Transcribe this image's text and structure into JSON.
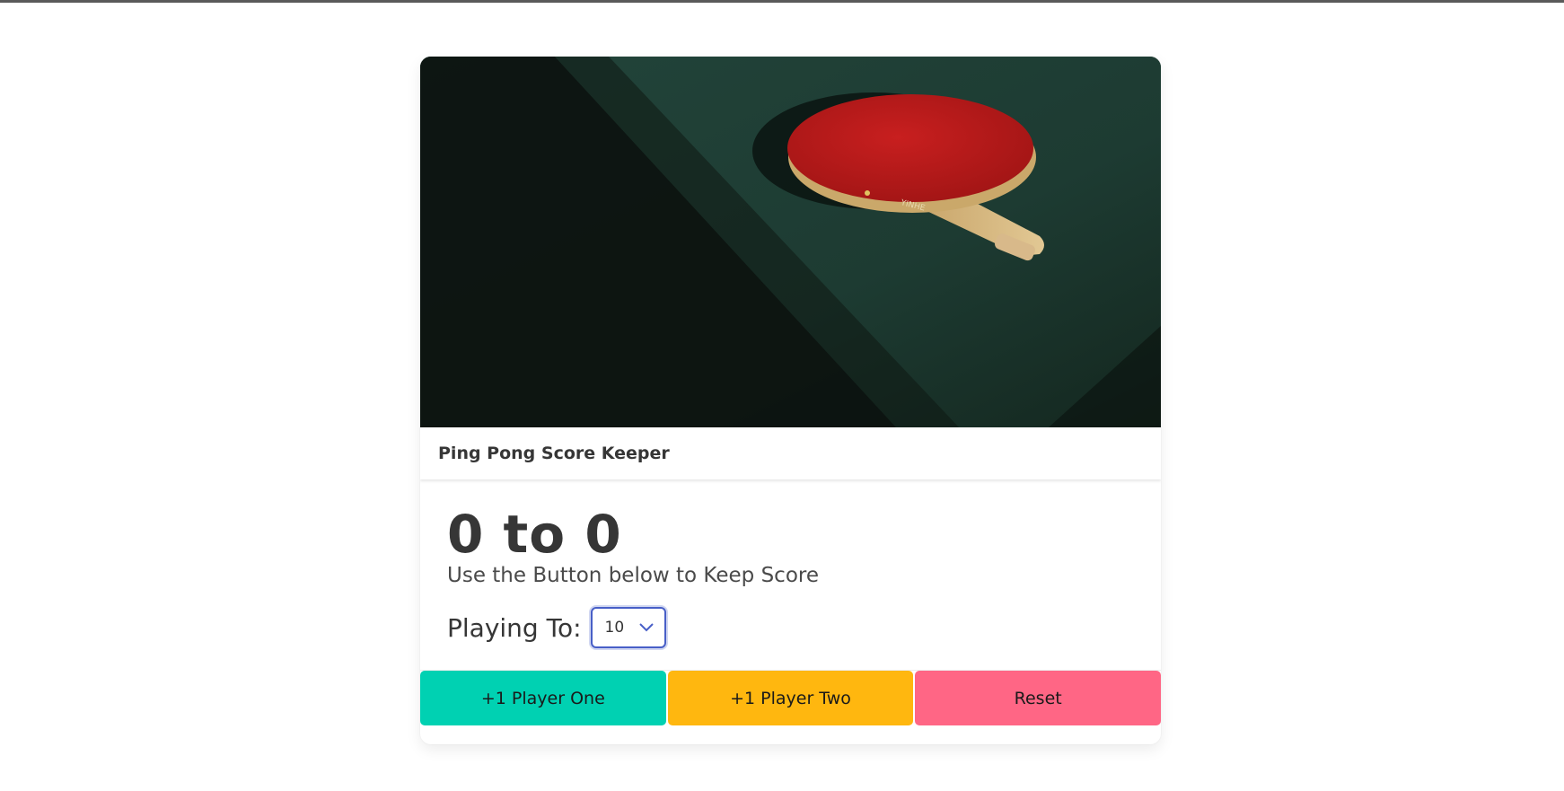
{
  "card": {
    "header_title": "Ping Pong Score Keeper",
    "image_alt": "red ping pong paddle on green table"
  },
  "score": {
    "player_one": "0",
    "player_two": "0",
    "display": "0 to 0",
    "instruction": "Use the Button below to Keep Score"
  },
  "playing_to": {
    "label": "Playing To:",
    "selected": "10"
  },
  "buttons": {
    "player_one": "+1 Player One",
    "player_two": "+1 Player Two",
    "reset": "Reset"
  },
  "colors": {
    "player_one_button": "#00d1b2",
    "player_two_button": "#ffb70f",
    "reset_button": "#ff6685",
    "select_border": "#485fc7",
    "text_dark": "#363636"
  }
}
